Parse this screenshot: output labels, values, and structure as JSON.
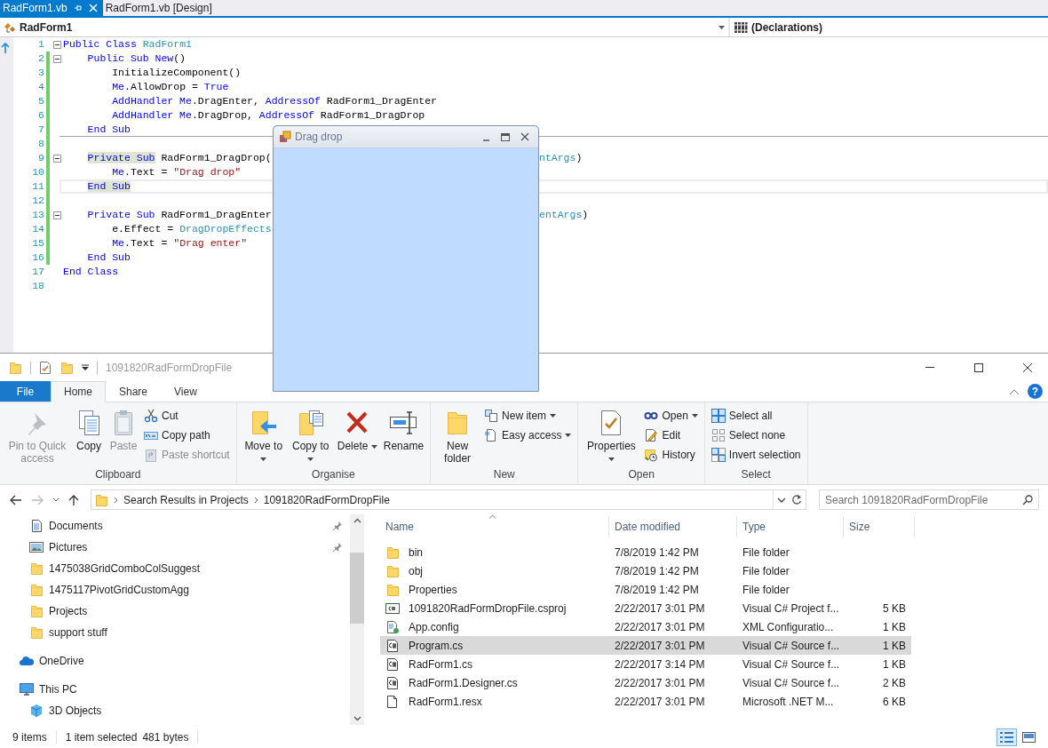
{
  "editor": {
    "tabs": [
      {
        "label": "RadForm1.vb",
        "selected": true
      },
      {
        "label": "RadForm1.vb [Design]",
        "selected": false
      }
    ],
    "type_dropdown": "RadForm1",
    "member_dropdown": "(Declarations)",
    "lines": [
      {
        "num": "1",
        "fold": true,
        "changed": false,
        "current": false,
        "separator": false,
        "segments": [
          {
            "kind": "keyword",
            "text": "Public Class "
          },
          {
            "kind": "type",
            "text": "RadForm1"
          }
        ],
        "children": [
          {
            "num": "2",
            "fold": true,
            "changed": true,
            "current": false,
            "separator": false,
            "segments": [
              {
                "kind": "keyword",
                "text": "Public Sub New"
              },
              {
                "kind": "plain",
                "text": "()"
              }
            ],
            "children": [
              {
                "num": "3",
                "fold": false,
                "changed": true,
                "current": false,
                "separator": false,
                "segments": [
                  {
                    "kind": "plain",
                    "text": "InitializeComponent()"
                  }
                ]
              },
              {
                "num": "4",
                "fold": false,
                "changed": true,
                "current": false,
                "separator": false,
                "segments": [
                  {
                    "kind": "keyword",
                    "text": "Me"
                  },
                  {
                    "kind": "plain",
                    "text": ".AllowDrop = "
                  },
                  {
                    "kind": "keyword",
                    "text": "True"
                  }
                ]
              },
              {
                "num": "5",
                "fold": false,
                "changed": true,
                "current": false,
                "separator": false,
                "segments": [
                  {
                    "kind": "keyword",
                    "text": "AddHandler Me"
                  },
                  {
                    "kind": "plain",
                    "text": ".DragEnter, "
                  },
                  {
                    "kind": "keyword",
                    "text": "AddressOf"
                  },
                  {
                    "kind": "plain",
                    "text": " RadForm1_DragEnter"
                  }
                ]
              },
              {
                "num": "6",
                "fold": false,
                "changed": true,
                "current": false,
                "separator": false,
                "segments": [
                  {
                    "kind": "keyword",
                    "text": "AddHandler Me"
                  },
                  {
                    "kind": "plain",
                    "text": ".DragDrop, "
                  },
                  {
                    "kind": "keyword",
                    "text": "AddressOf"
                  },
                  {
                    "kind": "plain",
                    "text": " RadForm1_DragDrop"
                  }
                ]
              }
            ]
          },
          {
            "num": "7",
            "fold": false,
            "changed": true,
            "current": false,
            "separator": true,
            "segments": [
              {
                "kind": "keyword",
                "text": "End Sub"
              }
            ]
          },
          {
            "num": "8",
            "fold": false,
            "changed": true,
            "current": false,
            "separator": false
          },
          {
            "num": "9",
            "fold": true,
            "changed": true,
            "current": false,
            "separator": false,
            "segments": [
              {
                "kind": "match",
                "text": "Private Sub"
              },
              {
                "kind": "plain",
                "text": " RadForm1_DragDrop("
              }
            ],
            "tail": [
              {
                "kind": "type",
                "text": "ntArgs"
              },
              {
                "kind": "plain",
                "text": ")"
              }
            ],
            "children": [
              {
                "num": "10",
                "fold": false,
                "changed": true,
                "current": false,
                "separator": false,
                "segments": [
                  {
                    "kind": "keyword",
                    "text": "Me"
                  },
                  {
                    "kind": "plain",
                    "text": ".Text = "
                  },
                  {
                    "kind": "string",
                    "text": "\"Drag drop\""
                  }
                ]
              }
            ]
          },
          {
            "num": "11",
            "fold": false,
            "changed": true,
            "current": true,
            "separator": true,
            "segments": [
              {
                "kind": "match",
                "text": "End Sub"
              }
            ]
          },
          {
            "num": "12",
            "fold": false,
            "changed": true,
            "current": false,
            "separator": false
          },
          {
            "num": "13",
            "fold": true,
            "changed": true,
            "current": false,
            "separator": false,
            "segments": [
              {
                "kind": "keyword",
                "text": "Private Sub"
              },
              {
                "kind": "plain",
                "text": " RadForm1_DragEnter"
              }
            ],
            "tail": [
              {
                "kind": "type",
                "text": "entArgs"
              },
              {
                "kind": "plain",
                "text": ")"
              }
            ],
            "children": [
              {
                "num": "14",
                "fold": false,
                "changed": true,
                "current": false,
                "separator": false,
                "segments": [
                  {
                    "kind": "plain",
                    "text": "e.Effect = "
                  },
                  {
                    "kind": "type",
                    "text": "DragDropEffects"
                  }
                ]
              },
              {
                "num": "15",
                "fold": false,
                "changed": true,
                "current": false,
                "separator": false,
                "segments": [
                  {
                    "kind": "keyword",
                    "text": "Me"
                  },
                  {
                    "kind": "plain",
                    "text": ".Text = "
                  },
                  {
                    "kind": "string",
                    "text": "\"Drag enter\""
                  }
                ]
              }
            ]
          },
          {
            "num": "16",
            "fold": false,
            "changed": true,
            "current": false,
            "separator": false,
            "segments": [
              {
                "kind": "keyword",
                "text": "End Sub"
              }
            ]
          }
        ]
      },
      {
        "num": "17",
        "fold": false,
        "changed": false,
        "current": false,
        "separator": false,
        "segments": [
          {
            "kind": "keyword",
            "text": "End Class"
          }
        ]
      },
      {
        "num": "18",
        "fold": false,
        "changed": false,
        "current": false,
        "separator": false
      }
    ]
  },
  "form_window": {
    "title": "Drag drop"
  },
  "explorer": {
    "title": "1091820RadFormDropFile",
    "help": "?",
    "ribbon_tabs": [
      {
        "label": "File",
        "kind": "file",
        "selected": false
      },
      {
        "label": "Home",
        "kind": "tab",
        "selected": true
      },
      {
        "label": "Share",
        "kind": "tab",
        "selected": false
      },
      {
        "label": "View",
        "kind": "tab",
        "selected": false
      }
    ],
    "ribbon_groups": [
      {
        "label": "Clipboard",
        "items": [
          {
            "label": "Pin to Quick access",
            "kind": "large",
            "disabled": true,
            "dropdown": false
          },
          {
            "label": "Copy",
            "kind": "large",
            "disabled": false,
            "dropdown": false
          },
          {
            "label": "Paste",
            "kind": "large",
            "disabled": true,
            "dropdown": false
          },
          {
            "label": "Cut",
            "kind": "small",
            "disabled": false,
            "dropdown": false
          },
          {
            "label": "Copy path",
            "kind": "small",
            "disabled": false,
            "dropdown": false
          },
          {
            "label": "Paste shortcut",
            "kind": "small",
            "disabled": true,
            "dropdown": false
          }
        ]
      },
      {
        "label": "Organise",
        "items": [
          {
            "label": "Move to",
            "kind": "large",
            "disabled": false,
            "dropdown": true
          },
          {
            "label": "Copy to",
            "kind": "large",
            "disabled": false,
            "dropdown": true
          },
          {
            "label": "Delete",
            "kind": "large",
            "disabled": false,
            "dropdown": true
          },
          {
            "label": "Rename",
            "kind": "large",
            "disabled": false,
            "dropdown": false
          }
        ]
      },
      {
        "label": "New",
        "items": [
          {
            "label": "New folder",
            "kind": "large",
            "disabled": false,
            "dropdown": false
          },
          {
            "label": "New item",
            "kind": "small",
            "disabled": false,
            "dropdown": true
          },
          {
            "label": "Easy access",
            "kind": "small",
            "disabled": false,
            "dropdown": true
          }
        ]
      },
      {
        "label": "Open",
        "items": [
          {
            "label": "Properties",
            "kind": "large",
            "disabled": false,
            "dropdown": true
          },
          {
            "label": "Open",
            "kind": "small",
            "disabled": false,
            "dropdown": true
          },
          {
            "label": "Edit",
            "kind": "small",
            "disabled": false,
            "dropdown": false
          },
          {
            "label": "History",
            "kind": "small",
            "disabled": false,
            "dropdown": false
          }
        ]
      },
      {
        "label": "Select",
        "items": [
          {
            "label": "Select all",
            "kind": "small",
            "disabled": false,
            "dropdown": false
          },
          {
            "label": "Select none",
            "kind": "small",
            "disabled": false,
            "dropdown": false
          },
          {
            "label": "Invert selection",
            "kind": "small",
            "disabled": false,
            "dropdown": false
          }
        ]
      }
    ],
    "nav": {
      "back_enabled": true,
      "forward_enabled": false
    },
    "crumbs": [
      "Search Results in Projects",
      "1091820RadFormDropFile"
    ],
    "search": {
      "placeholder": "Search 1091820RadFormDropFile"
    },
    "quick_access": [
      {
        "label": "Documents",
        "kind": "documents",
        "pinned": true
      },
      {
        "label": "Pictures",
        "kind": "pictures",
        "pinned": true
      },
      {
        "label": "1475038GridComboColSuggest",
        "kind": "folder",
        "pinned": false
      },
      {
        "label": "1475117PivotGridCustomAgg",
        "kind": "folder",
        "pinned": false
      },
      {
        "label": "Projects",
        "kind": "folder",
        "pinned": false
      },
      {
        "label": "support stuff",
        "kind": "folder",
        "pinned": false
      }
    ],
    "tree": [
      {
        "label": "OneDrive",
        "kind": "cloud"
      },
      {
        "label": "This PC",
        "kind": "computer",
        "children": [
          {
            "label": "3D Objects",
            "kind": "cube"
          }
        ]
      }
    ],
    "columns": [
      "Name",
      "Date modified",
      "Type",
      "Size"
    ],
    "files": [
      {
        "name": "bin",
        "date": "7/8/2019 1:42 PM",
        "type": "File folder",
        "kind": "folder",
        "selected": false
      },
      {
        "name": "obj",
        "date": "7/8/2019 1:42 PM",
        "type": "File folder",
        "kind": "folder",
        "selected": false
      },
      {
        "name": "Properties",
        "date": "7/8/2019 1:42 PM",
        "type": "File folder",
        "kind": "folder",
        "selected": false
      },
      {
        "name": "1091820RadFormDropFile.csproj",
        "date": "2/22/2017 3:01 PM",
        "type": "Visual C# Project f...",
        "size": "5 KB",
        "kind": "project",
        "selected": false
      },
      {
        "name": "App.config",
        "date": "2/22/2017 3:01 PM",
        "type": "XML Configuratio...",
        "size": "1 KB",
        "kind": "config",
        "selected": false
      },
      {
        "name": "Program.cs",
        "date": "2/22/2017 3:01 PM",
        "type": "Visual C# Source f...",
        "size": "1 KB",
        "kind": "source",
        "selected": true
      },
      {
        "name": "RadForm1.cs",
        "date": "2/22/2017 3:14 PM",
        "type": "Visual C# Source f...",
        "size": "1 KB",
        "kind": "source",
        "selected": false
      },
      {
        "name": "RadForm1.Designer.cs",
        "date": "2/22/2017 3:01 PM",
        "type": "Visual C# Source f...",
        "size": "2 KB",
        "kind": "source",
        "selected": false
      },
      {
        "name": "RadForm1.resx",
        "date": "2/22/2017 3:01 PM",
        "type": "Microsoft .NET M...",
        "size": "6 KB",
        "kind": "file",
        "selected": false
      }
    ],
    "status": {
      "count": "9 items",
      "selection": "1 item selected",
      "size": "481 bytes"
    },
    "views": [
      {
        "kind": "details",
        "selected": true
      },
      {
        "kind": "large-icons",
        "selected": false
      }
    ]
  }
}
